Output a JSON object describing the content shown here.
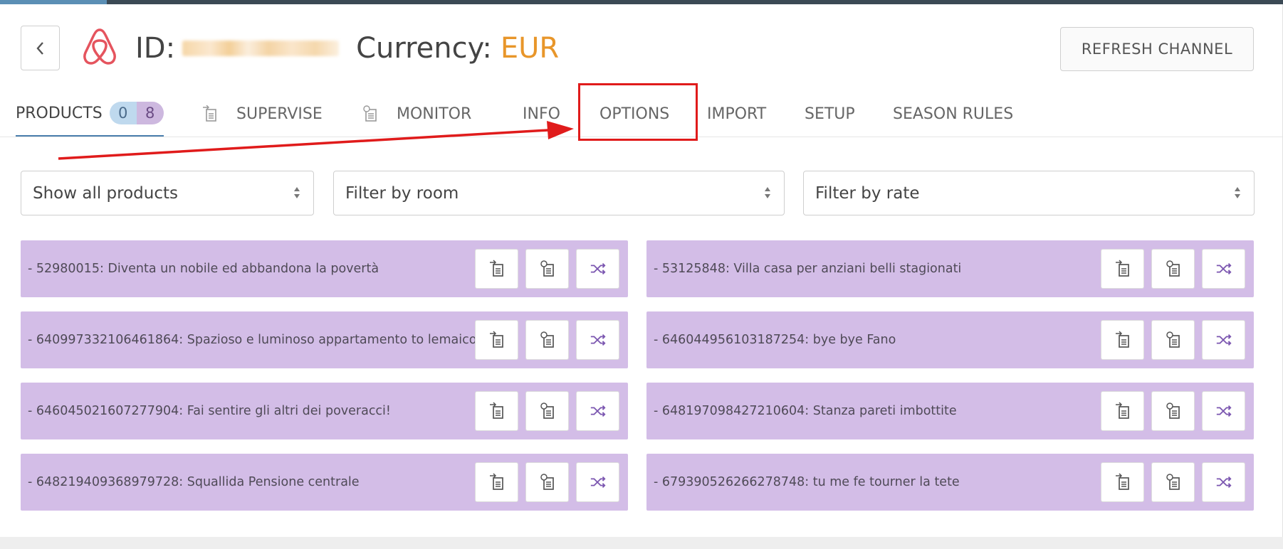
{
  "header": {
    "back_icon": "chevron-left-icon",
    "logo_icon": "airbnb-logo-icon",
    "id_label": "ID:",
    "currency_label": "Currency:",
    "currency_value": "EUR",
    "refresh_label": "REFRESH CHANNEL"
  },
  "tabs": {
    "products": {
      "label": "PRODUCTS",
      "count_a": "0",
      "count_b": "8"
    },
    "supervise": {
      "label": "SUPERVISE"
    },
    "monitor": {
      "label": "MONITOR"
    },
    "info": {
      "label": "INFO"
    },
    "options": {
      "label": "OPTIONS"
    },
    "import": {
      "label": "IMPORT"
    },
    "setup": {
      "label": "SETUP"
    },
    "season_rules": {
      "label": "SEASON RULES"
    }
  },
  "filters": {
    "products": {
      "value": "Show all products"
    },
    "room": {
      "value": "Filter by room"
    },
    "rate": {
      "value": "Filter by rate"
    }
  },
  "products": [
    {
      "label": "- 52980015: Diventa un nobile ed abbandona la povertà"
    },
    {
      "label": "- 53125848: Villa casa per anziani belli stagionati"
    },
    {
      "label": "- 640997332106461864: Spazioso e luminoso appartamento to lemaico"
    },
    {
      "label": "- 646044956103187254: bye bye Fano"
    },
    {
      "label": "- 646045021607277904: Fai sentire gli altri dei poveracci!"
    },
    {
      "label": "- 648197098427210604: Stanza pareti imbottite"
    },
    {
      "label": "- 648219409368979728: Squallida Pensione centrale"
    },
    {
      "label": "- 679390526266278748: tu me fe tourner la tete"
    }
  ],
  "colors": {
    "accent_orange": "#e8962a",
    "card_purple": "#d3bde7",
    "annotation_red": "#e01b1b",
    "active_tab_underline": "#4a7fad"
  }
}
